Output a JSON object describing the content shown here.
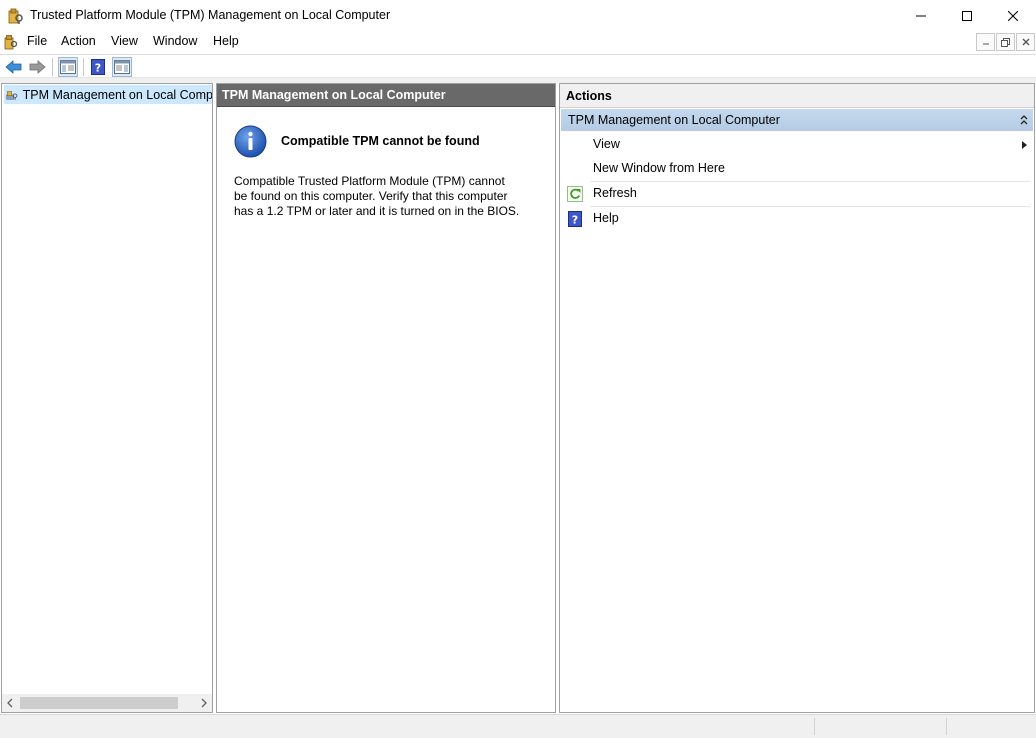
{
  "window": {
    "title": "Trusted Platform Module (TPM) Management on Local Computer",
    "app_icon": "tpm-key-icon"
  },
  "menu": {
    "items": [
      "File",
      "Action",
      "View",
      "Window",
      "Help"
    ]
  },
  "toolbar": {
    "buttons": [
      "back-arrow-icon",
      "forward-arrow-icon",
      "show-hide-console-tree-icon",
      "help-icon",
      "show-hide-action-pane-icon"
    ]
  },
  "tree": {
    "root_label": "TPM Management on Local Comp"
  },
  "center": {
    "header": "TPM Management on Local Computer",
    "info_title": "Compatible TPM cannot be found",
    "info_body": [
      "Compatible Trusted Platform Module (TPM) cannot",
      "be found on this computer. Verify that this computer",
      "has a 1.2 TPM or later and it is turned on in the BIOS."
    ]
  },
  "actions": {
    "header": "Actions",
    "group_label": "TPM Management on Local Computer",
    "items": [
      {
        "label": "View",
        "icon": "",
        "submenu": true
      },
      {
        "label": "New Window from Here",
        "icon": "",
        "submenu": false
      },
      {
        "label": "Refresh",
        "icon": "refresh-icon",
        "submenu": false
      },
      {
        "label": "Help",
        "icon": "help-icon",
        "submenu": false
      }
    ]
  },
  "colors": {
    "selection": "#cce8ff",
    "center_header": "#696969",
    "actions_group": "#b4cbe4"
  }
}
